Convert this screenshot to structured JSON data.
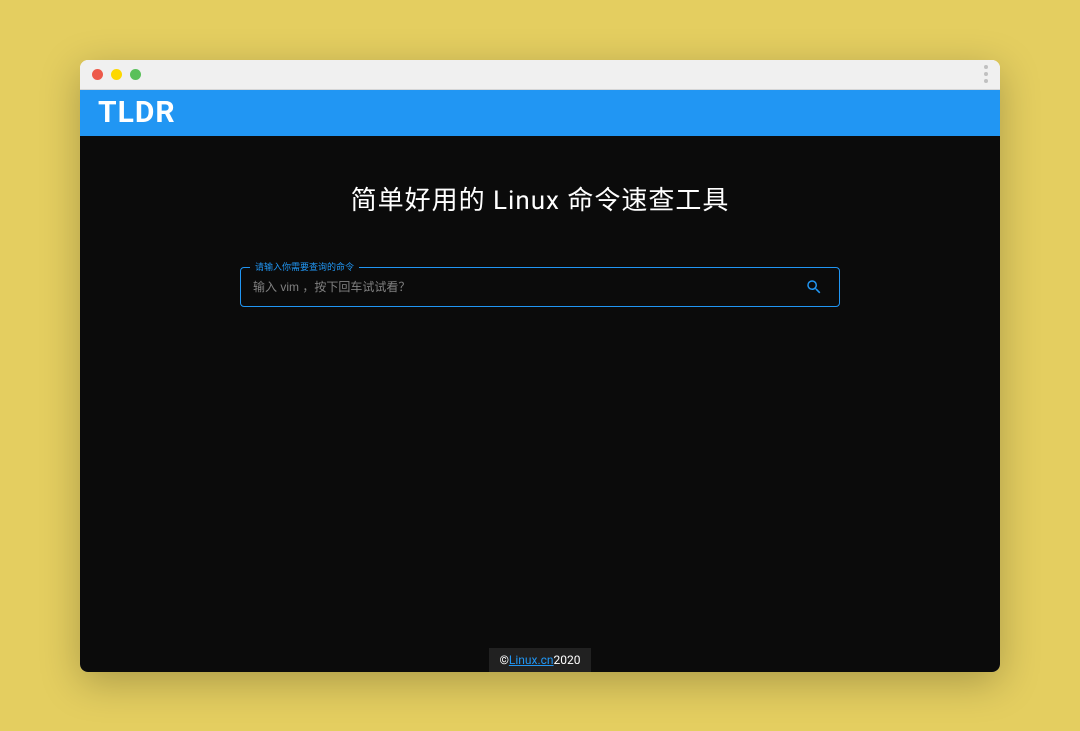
{
  "header": {
    "title": "TLDR"
  },
  "main": {
    "tagline": "简单好用的 Linux 命令速查工具",
    "search": {
      "legend": "请输入你需要查询的命令",
      "placeholder": "输入 vim ，按下回车试试看？"
    }
  },
  "footer": {
    "prefix": "© ",
    "link_text": "Linux.cn",
    "year": " 2020"
  }
}
